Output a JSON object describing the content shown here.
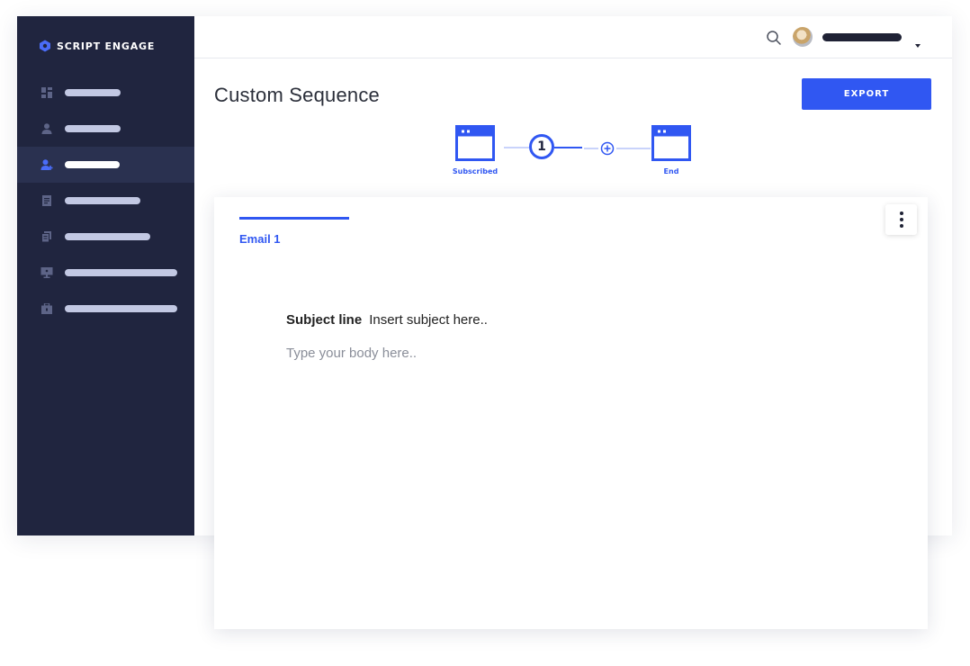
{
  "brand": {
    "name": "SCRIPT ENGAGE",
    "logo_icon": "hexagon-logo-icon",
    "logo_color": "#4a6cf7"
  },
  "sidebar": {
    "background": "#20253f",
    "active_index": 2,
    "items": [
      {
        "icon": "dashboard-icon"
      },
      {
        "icon": "user-icon"
      },
      {
        "icon": "add-user-icon"
      },
      {
        "icon": "document-icon"
      },
      {
        "icon": "copy-icon"
      },
      {
        "icon": "monitor-icon"
      },
      {
        "icon": "briefcase-icon"
      }
    ]
  },
  "topbar": {
    "search_icon": "search-icon",
    "avatar": "user-avatar",
    "menu_caret": "caret-down-icon"
  },
  "page": {
    "title": "Custom Sequence"
  },
  "toolbar": {
    "export_label": "EXPORT"
  },
  "sequence": {
    "start_label": "Subscribed",
    "step_number": "1",
    "end_label": "End",
    "accent": "#3057f2",
    "connector_light": "#c9d3fb"
  },
  "email": {
    "tab_label": "Email 1",
    "subject_label": "Subject line",
    "subject_placeholder": "Insert subject here..",
    "body_placeholder": "Type your body here.."
  }
}
